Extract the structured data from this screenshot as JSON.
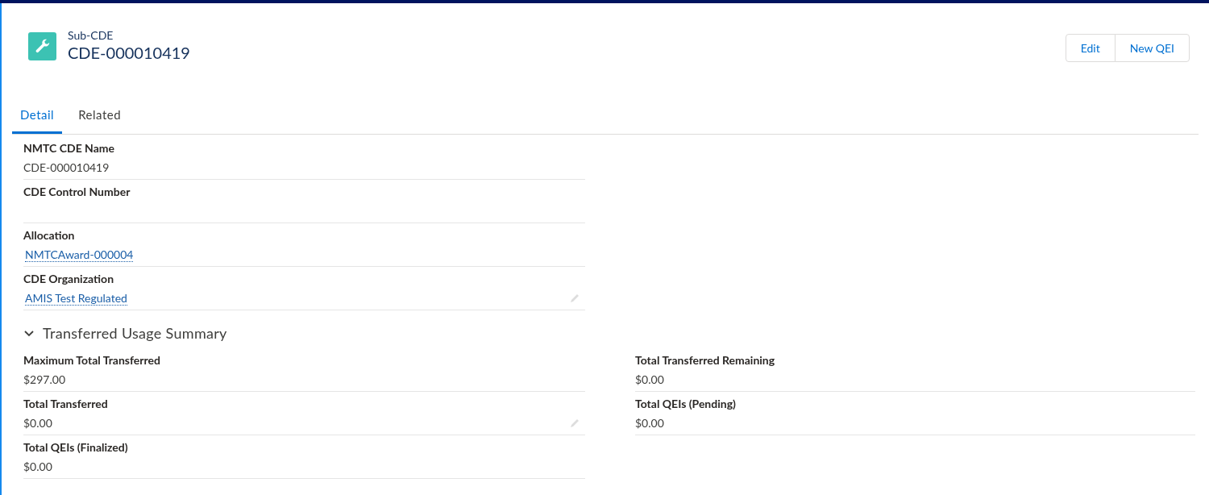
{
  "header": {
    "object_type": "Sub-CDE",
    "record_name": "CDE-000010419"
  },
  "actions": [
    "Edit",
    "New QEI"
  ],
  "tabs": [
    {
      "label": "Detail",
      "selected": true
    },
    {
      "label": "Related",
      "selected": false
    }
  ],
  "fields": [
    {
      "label": "NMTC CDE Name",
      "value": "CDE-000010419",
      "kind": "text",
      "editable": false
    },
    {
      "label": "CDE Control Number",
      "editable": false
    },
    {
      "label": "Allocation",
      "value": "NMTCAward-000004",
      "kind": "link",
      "editable": false
    },
    {
      "label": "CDE Organization",
      "value": "AMIS Test Regulated",
      "kind": "link",
      "editable": true
    }
  ],
  "section": {
    "title": "Transferred Usage Summary",
    "expanded": true,
    "left_fields": [
      {
        "label": "Maximum Total Transferred",
        "value": "$297.00",
        "kind": "text",
        "editable": false
      },
      {
        "label": "Total Transferred",
        "value": "$0.00",
        "kind": "text",
        "editable": true
      },
      {
        "label": "Total QEIs (Finalized)",
        "value": "$0.00",
        "kind": "text",
        "editable": false
      }
    ],
    "right_fields": [
      {
        "label": "Total Transferred Remaining",
        "value": "$0.00",
        "kind": "text",
        "editable": false
      },
      {
        "label": "Total QEIs (Pending)",
        "value": "$0.00",
        "kind": "text",
        "editable": false
      }
    ]
  }
}
